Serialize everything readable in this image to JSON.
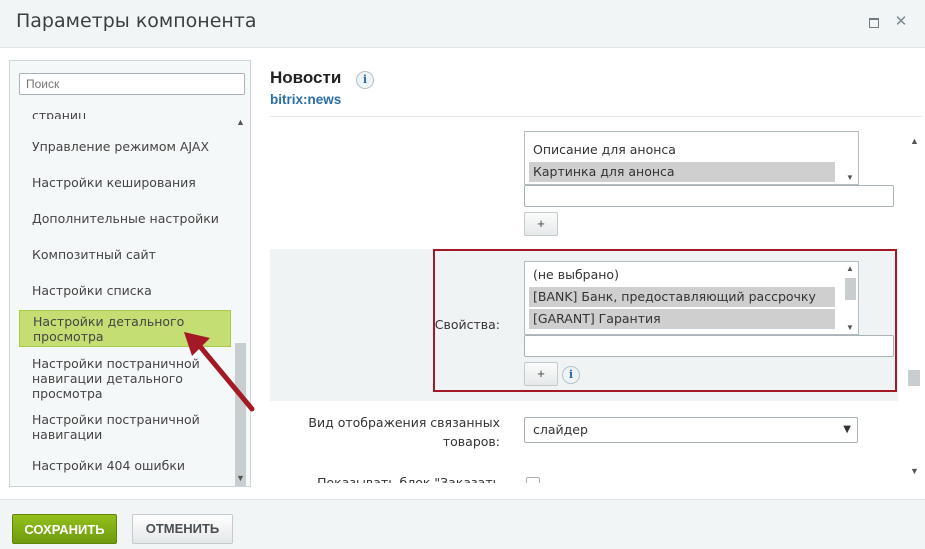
{
  "window": {
    "title": "Параметры компонента"
  },
  "sidebar": {
    "search_placeholder": "Поиск",
    "items": [
      {
        "label": "страниц"
      },
      {
        "label": "Управление режимом AJAX"
      },
      {
        "label": "Настройки кеширования"
      },
      {
        "label": "Дополнительные настройки"
      },
      {
        "label": "Композитный сайт"
      },
      {
        "label": "Настройки списка"
      },
      {
        "label": "Настройки детального просмотра",
        "active": true
      },
      {
        "label": "Настройки постраничной навигации детального просмотра"
      },
      {
        "label": "Настройки постраничной навигации"
      },
      {
        "label": "Настройки 404 ошибки"
      }
    ]
  },
  "component": {
    "title": "Новости",
    "code": "bitrix:news"
  },
  "fields_list_top": {
    "options": [
      {
        "label": "Описание для анонса",
        "selected": false
      },
      {
        "label": "Картинка для анонса",
        "selected": true
      }
    ]
  },
  "properties": {
    "label": "Свойства:",
    "options": [
      {
        "label": "(не выбрано)",
        "selected": false
      },
      {
        "label": "[BANK] Банк, предоставляющий рассрочку",
        "selected": true
      },
      {
        "label": "[GARANT] Гарантия",
        "selected": true
      }
    ]
  },
  "buttons": {
    "add": "+"
  },
  "related_view": {
    "label": "Вид отображения связанных товаров:",
    "value": "слайдер"
  },
  "order_block": {
    "label": "Показывать блок \"Заказать услугу\":"
  },
  "footer": {
    "save": "СОХРАНИТЬ",
    "cancel": "ОТМЕНИТЬ"
  },
  "colors": {
    "accent_green": "#7ba714",
    "active_item": "#c4de74",
    "highlight_red": "#a31925",
    "link_blue": "#2a6fa8"
  }
}
